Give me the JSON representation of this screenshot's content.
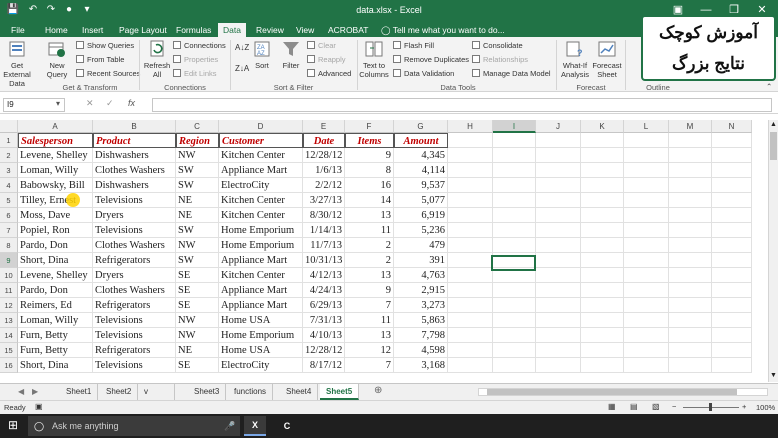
{
  "window": {
    "title": "data.xlsx - Excel",
    "minimize": "—",
    "restore": "❒",
    "close": "✕"
  },
  "ribbon_tabs": [
    "File",
    "Home",
    "Insert",
    "Page Layout",
    "Formulas",
    "Data",
    "Review",
    "View",
    "ACROBAT"
  ],
  "tell_me": "Tell me what you want to do...",
  "ribbon": {
    "get_external": "Get External Data",
    "new_query": "New Query",
    "show_queries": "Show Queries",
    "from_table": "From Table",
    "recent_sources": "Recent Sources",
    "refresh_all": "Refresh All",
    "connections": "Connections",
    "properties": "Properties",
    "edit_links": "Edit Links",
    "sort": "Sort",
    "filter": "Filter",
    "clear": "Clear",
    "reapply": "Reapply",
    "advanced": "Advanced",
    "text_to_columns": "Text to Columns",
    "flash_fill": "Flash Fill",
    "remove_duplicates": "Remove Duplicates",
    "data_validation": "Data Validation",
    "consolidate": "Consolidate",
    "relationships": "Relationships",
    "manage_data_model": "Manage Data Model",
    "what_if": "What-If Analysis",
    "forecast_sheet": "Forecast Sheet",
    "groups": {
      "get_transform": "Get & Transform",
      "connections": "Connections",
      "sort_filter": "Sort & Filter",
      "data_tools": "Data Tools",
      "forecast": "Forecast",
      "outline": "Outline"
    }
  },
  "overlay": {
    "line1": "آموزش کوچک",
    "line2": "نتایج بزرگ"
  },
  "formula_bar": {
    "name_box": "I9",
    "fx": "fx",
    "value": ""
  },
  "columns": [
    "A",
    "B",
    "C",
    "D",
    "E",
    "F",
    "G",
    "H",
    "I",
    "J",
    "K",
    "L",
    "M",
    "N"
  ],
  "headers": [
    "Salesperson",
    "Product",
    "Region",
    "Customer",
    "Date",
    "Items",
    "Amount"
  ],
  "rows": [
    [
      "Levene, Shelley",
      "Dishwashers",
      "NW",
      "Kitchen Center",
      "12/28/12",
      "9",
      "4,345"
    ],
    [
      "Loman, Willy",
      "Clothes Washers",
      "SW",
      "Appliance Mart",
      "1/6/13",
      "8",
      "4,114"
    ],
    [
      "Babowsky, Bill",
      "Dishwashers",
      "SW",
      "ElectroCity",
      "2/2/12",
      "16",
      "9,537"
    ],
    [
      "Tilley, Ernest",
      "Televisions",
      "NE",
      "Kitchen Center",
      "3/27/13",
      "14",
      "5,077"
    ],
    [
      "Moss, Dave",
      "Dryers",
      "NE",
      "Kitchen Center",
      "8/30/12",
      "13",
      "6,919"
    ],
    [
      "Popiel, Ron",
      "Televisions",
      "SW",
      "Home Emporium",
      "1/14/13",
      "11",
      "5,236"
    ],
    [
      "Pardo, Don",
      "Clothes Washers",
      "NW",
      "Home Emporium",
      "11/7/13",
      "2",
      "479"
    ],
    [
      "Short, Dina",
      "Refrigerators",
      "SW",
      "Appliance Mart",
      "10/31/13",
      "2",
      "391"
    ],
    [
      "Levene, Shelley",
      "Dryers",
      "SE",
      "Kitchen Center",
      "4/12/13",
      "13",
      "4,763"
    ],
    [
      "Pardo, Don",
      "Clothes Washers",
      "SE",
      "Appliance Mart",
      "4/24/13",
      "9",
      "2,915"
    ],
    [
      "Reimers, Ed",
      "Refrigerators",
      "SE",
      "Appliance Mart",
      "6/29/13",
      "7",
      "3,273"
    ],
    [
      "Loman, Willy",
      "Televisions",
      "NW",
      "Home USA",
      "7/31/13",
      "11",
      "5,863"
    ],
    [
      "Furn, Betty",
      "Televisions",
      "NW",
      "Home Emporium",
      "4/10/13",
      "13",
      "7,798"
    ],
    [
      "Furn, Betty",
      "Refrigerators",
      "NE",
      "Home USA",
      "12/28/12",
      "12",
      "4,598"
    ],
    [
      "Short, Dina",
      "Televisions",
      "SE",
      "ElectroCity",
      "8/17/12",
      "7",
      "3,168"
    ]
  ],
  "sheets": [
    "Sheet1",
    "Sheet2",
    "v lookup",
    "Sheet3",
    "functions",
    "Sheet4",
    "Sheet5"
  ],
  "active_sheet": "Sheet5",
  "status": {
    "ready": "Ready",
    "zoom": "100%"
  },
  "taskbar": {
    "search": "Ask me anything"
  }
}
